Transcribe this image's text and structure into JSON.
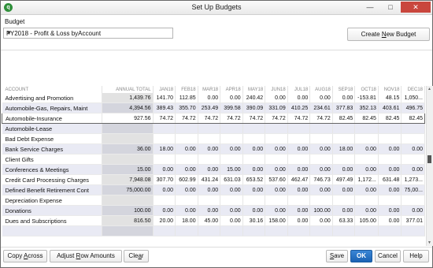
{
  "window": {
    "title": "Set Up Budgets",
    "app_icon": "qb-app-icon"
  },
  "budget": {
    "label": "Budget",
    "selected": "FY2018 - Profit & Loss byAccount"
  },
  "create_button": {
    "label_pre": "Create ",
    "label_u": "N",
    "label_post": "ew Budget"
  },
  "grid": {
    "columns": [
      "ACCOUNT",
      "ANNUAL TOTAL",
      "JAN18",
      "FEB18",
      "MAR18",
      "APR18",
      "MAY18",
      "JUN18",
      "JUL18",
      "AUG18",
      "SEP18",
      "OCT18",
      "NOV18",
      "DEC18"
    ],
    "selected_row": 2,
    "rows": [
      {
        "account": "Advertising and Promotion",
        "values": [
          "1,439.76",
          "141.70",
          "112.85",
          "0.00",
          "0.00",
          "240.42",
          "0.00",
          "0.00",
          "0.00",
          "0.00",
          "-153.81",
          "48.15",
          "1,050..."
        ]
      },
      {
        "account": "Automobile-Gas, Repairs, Maint",
        "values": [
          "4,394.56",
          "389.43",
          "355.70",
          "253.49",
          "399.58",
          "390.09",
          "331.09",
          "410.25",
          "234.61",
          "377.83",
          "352.13",
          "403.61",
          "496.75"
        ]
      },
      {
        "account": "Automobile-Insurance",
        "values": [
          "927.56",
          "74.72",
          "74.72",
          "74.72",
          "74.72",
          "74.72",
          "74.72",
          "74.72",
          "74.72",
          "82.45",
          "82.45",
          "82.45",
          "82.45"
        ]
      },
      {
        "account": "Automobile-Lease",
        "values": [
          "",
          "",
          "",
          "",
          "",
          "",
          "",
          "",
          "",
          "",
          "",
          "",
          ""
        ]
      },
      {
        "account": "Bad Debt Expense",
        "values": [
          "",
          "",
          "",
          "",
          "",
          "",
          "",
          "",
          "",
          "",
          "",
          "",
          ""
        ]
      },
      {
        "account": "Bank Service Charges",
        "values": [
          "36.00",
          "18.00",
          "0.00",
          "0.00",
          "0.00",
          "0.00",
          "0.00",
          "0.00",
          "0.00",
          "18.00",
          "0.00",
          "0.00",
          "0.00"
        ]
      },
      {
        "account": "Client Gifts",
        "values": [
          "",
          "",
          "",
          "",
          "",
          "",
          "",
          "",
          "",
          "",
          "",
          "",
          ""
        ]
      },
      {
        "account": "Conferences & Meetings",
        "values": [
          "15.00",
          "0.00",
          "0.00",
          "0.00",
          "15.00",
          "0.00",
          "0.00",
          "0.00",
          "0.00",
          "0.00",
          "0.00",
          "0.00",
          "0.00"
        ]
      },
      {
        "account": "Credit Card Processing Charges",
        "values": [
          "7,948.08",
          "307.70",
          "602.99",
          "431.24",
          "631.03",
          "653.52",
          "537.60",
          "462.47",
          "746.73",
          "497.49",
          "1,172...",
          "631.48",
          "1,273..."
        ]
      },
      {
        "account": "Defined Benefit Retirement Cont",
        "values": [
          "75,000.00",
          "0.00",
          "0.00",
          "0.00",
          "0.00",
          "0.00",
          "0.00",
          "0.00",
          "0.00",
          "0.00",
          "0.00",
          "0.00",
          "75,00..."
        ]
      },
      {
        "account": "Depreciation Expense",
        "values": [
          "",
          "",
          "",
          "",
          "",
          "",
          "",
          "",
          "",
          "",
          "",
          "",
          ""
        ]
      },
      {
        "account": "Donations",
        "values": [
          "100.00",
          "0.00",
          "0.00",
          "0.00",
          "0.00",
          "0.00",
          "0.00",
          "0.00",
          "100.00",
          "0.00",
          "0.00",
          "0.00",
          "0.00"
        ]
      },
      {
        "account": "Dues and Subscriptions",
        "values": [
          "816.50",
          "20.00",
          "18.00",
          "45.00",
          "0.00",
          "30.16",
          "158.00",
          "0.00",
          "0.00",
          "63.33",
          "105.00",
          "0.00",
          "377.01"
        ]
      },
      {
        "account": "",
        "values": [
          "",
          "",
          "",
          "",
          "",
          "",
          "",
          "",
          "",
          "",
          "",
          "",
          ""
        ]
      }
    ]
  },
  "buttons": {
    "copy_pre": "Copy ",
    "copy_u": "A",
    "copy_post": "cross",
    "adjust_pre": "Adjust ",
    "adjust_u": "R",
    "adjust_post": "ow Amounts",
    "clear_pre": "Cle",
    "clear_u": "a",
    "clear_post": "r",
    "save_pre": "",
    "save_u": "S",
    "save_post": "ave",
    "ok": "OK",
    "cancel": "Cancel",
    "help": "Help"
  },
  "icons": {
    "dropdown": "chevron-down-icon",
    "close": "close-icon",
    "minimize": "minimize-icon",
    "maximize": "maximize-icon"
  }
}
